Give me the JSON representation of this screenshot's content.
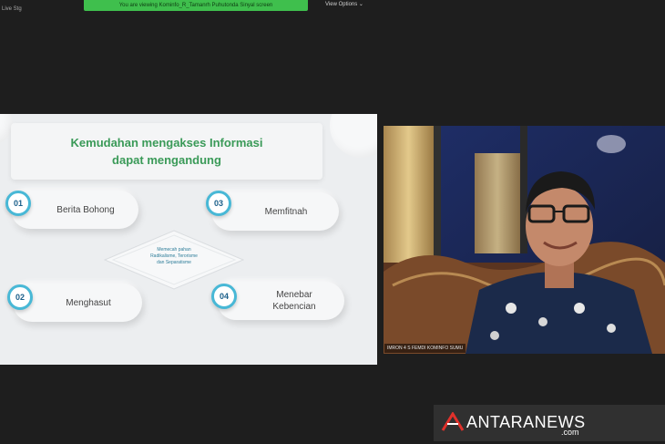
{
  "top_bar": {
    "banner_text": "You are viewing Kominfo_R_Tamanrh Puhutonda Sinyal screen",
    "captions_label": "View Options",
    "recording_tag": "Live Stg"
  },
  "slide": {
    "title_line1": "Kemudahan mengakses Informasi",
    "title_line2": "dapat mengandung",
    "items": [
      {
        "number": "01",
        "label": "Berita Bohong"
      },
      {
        "number": "03",
        "label": "Memfitnah"
      },
      {
        "number": "02",
        "label": "Menghasut"
      },
      {
        "number": "04",
        "label": "Menebar\nKebencian"
      }
    ],
    "center_text": "Memecah pahan\nRadikalisme, Terorisme\ndan Separatisme"
  },
  "video": {
    "participant_name": "IMRON 4 S FEMDI KOMINFO SUMU"
  },
  "watermark": {
    "brand": "ANTARANEWS",
    "domain": ".com",
    "accent_color": "#e0312b"
  },
  "colors": {
    "title_green": "#3a9a58",
    "badge_blue": "#48b8d6",
    "banner_green": "#3fbf4d"
  }
}
